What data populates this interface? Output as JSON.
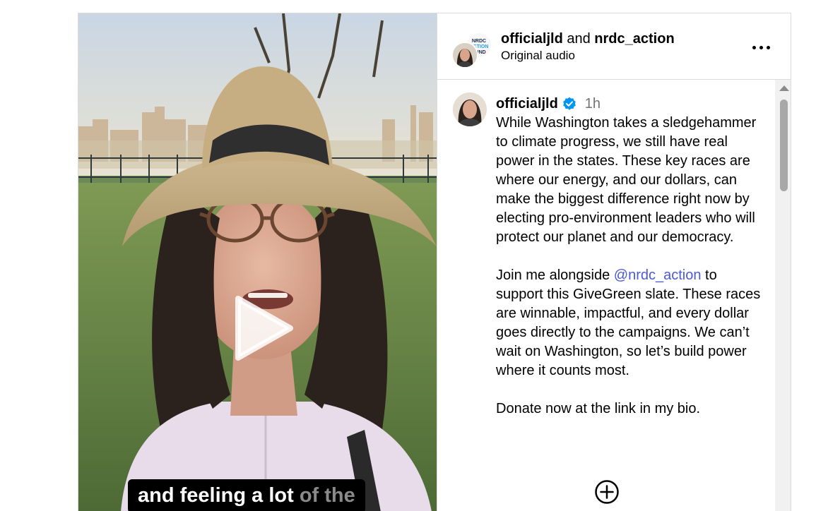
{
  "header": {
    "user_primary": "officialjld",
    "connector": "and",
    "user_secondary": "nrdc_action",
    "audio_label": "Original audio",
    "more_icon": "more-horizontal-icon"
  },
  "video": {
    "play_icon": "play-icon",
    "caption_spoken": "and feeling a lot",
    "caption_upcoming": "of the"
  },
  "comment": {
    "username": "officialjld",
    "verified_icon": "verified-badge-icon",
    "time": "1h",
    "paragraph_1": "While Washington takes a sledgehammer to climate progress, we still have real power in the states. These key races are where our energy, and our dollars, can make the biggest difference right now by electing pro-environment leaders who will protect our planet and our democracy.",
    "paragraph_2_before": "Join me alongside",
    "paragraph_2_mention": "@nrdc_action",
    "paragraph_2_after": "to support this GiveGreen slate. These races are winnable, impactful, and every dollar goes directly to the campaigns. We can’t wait on Washington, so let’s build power where it counts most.",
    "paragraph_3": "Donate now at the link in my bio.",
    "load_more_icon": "plus-circle-icon"
  },
  "colors": {
    "verified": "#0095f6",
    "mention": "#4b59d6",
    "timestamp": "#737373",
    "border": "#dbdbdb"
  }
}
